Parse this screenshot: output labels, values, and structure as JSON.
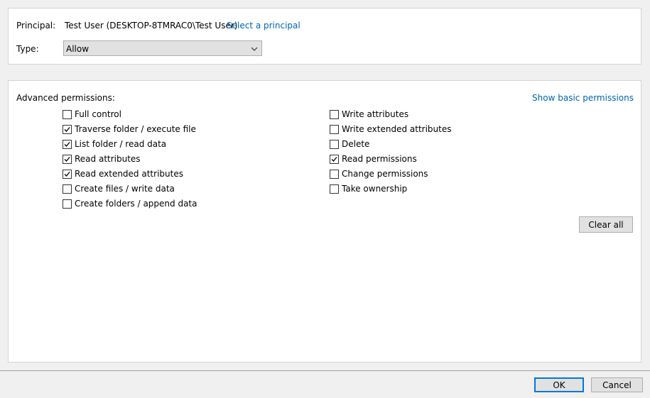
{
  "principal": {
    "label": "Principal:",
    "value": "Test User (DESKTOP-8TMRAC0\\Test User)",
    "select_link": "Select a principal"
  },
  "type": {
    "label": "Type:",
    "selected": "Allow"
  },
  "permissions": {
    "heading": "Advanced permissions:",
    "show_basic_link": "Show basic permissions",
    "left": [
      {
        "label": "Full control",
        "checked": false
      },
      {
        "label": "Traverse folder / execute file",
        "checked": true
      },
      {
        "label": "List folder / read data",
        "checked": true
      },
      {
        "label": "Read attributes",
        "checked": true
      },
      {
        "label": "Read extended attributes",
        "checked": true
      },
      {
        "label": "Create files / write data",
        "checked": false
      },
      {
        "label": "Create folders / append data",
        "checked": false
      }
    ],
    "right": [
      {
        "label": "Write attributes",
        "checked": false
      },
      {
        "label": "Write extended attributes",
        "checked": false
      },
      {
        "label": "Delete",
        "checked": false
      },
      {
        "label": "Read permissions",
        "checked": true
      },
      {
        "label": "Change permissions",
        "checked": false
      },
      {
        "label": "Take ownership",
        "checked": false
      }
    ],
    "clear_all": "Clear all"
  },
  "footer": {
    "ok": "OK",
    "cancel": "Cancel"
  }
}
